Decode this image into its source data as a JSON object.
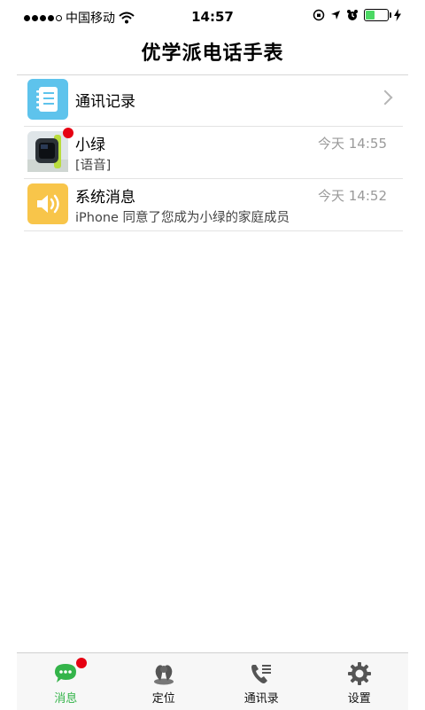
{
  "status_bar": {
    "carrier": "中国移动",
    "time": "14:57",
    "battery_level": 0.45,
    "colors": {
      "battery": "#4cd964"
    }
  },
  "header": {
    "title": "优学派电话手表"
  },
  "list": {
    "call_log": {
      "label": "通讯记录",
      "icon": "notebook-icon"
    },
    "items": [
      {
        "title": "小绿",
        "subtitle": "[语音]",
        "time": "今天 14:55",
        "icon": "watch-avatar",
        "unread": true
      },
      {
        "title": "系统消息",
        "subtitle": "iPhone 同意了您成为小绿的家庭成员",
        "time": "今天 14:52",
        "icon": "speaker-icon",
        "unread": false
      }
    ]
  },
  "tabbar": {
    "tabs": [
      {
        "label": "消息",
        "icon": "chat-icon",
        "active": true,
        "badge": true
      },
      {
        "label": "定位",
        "icon": "location-icon",
        "active": false
      },
      {
        "label": "通讯录",
        "icon": "phone-book-icon",
        "active": false
      },
      {
        "label": "设置",
        "icon": "gear-icon",
        "active": false
      }
    ],
    "colors": {
      "active": "#34b44a",
      "badge": "#e60012"
    }
  }
}
